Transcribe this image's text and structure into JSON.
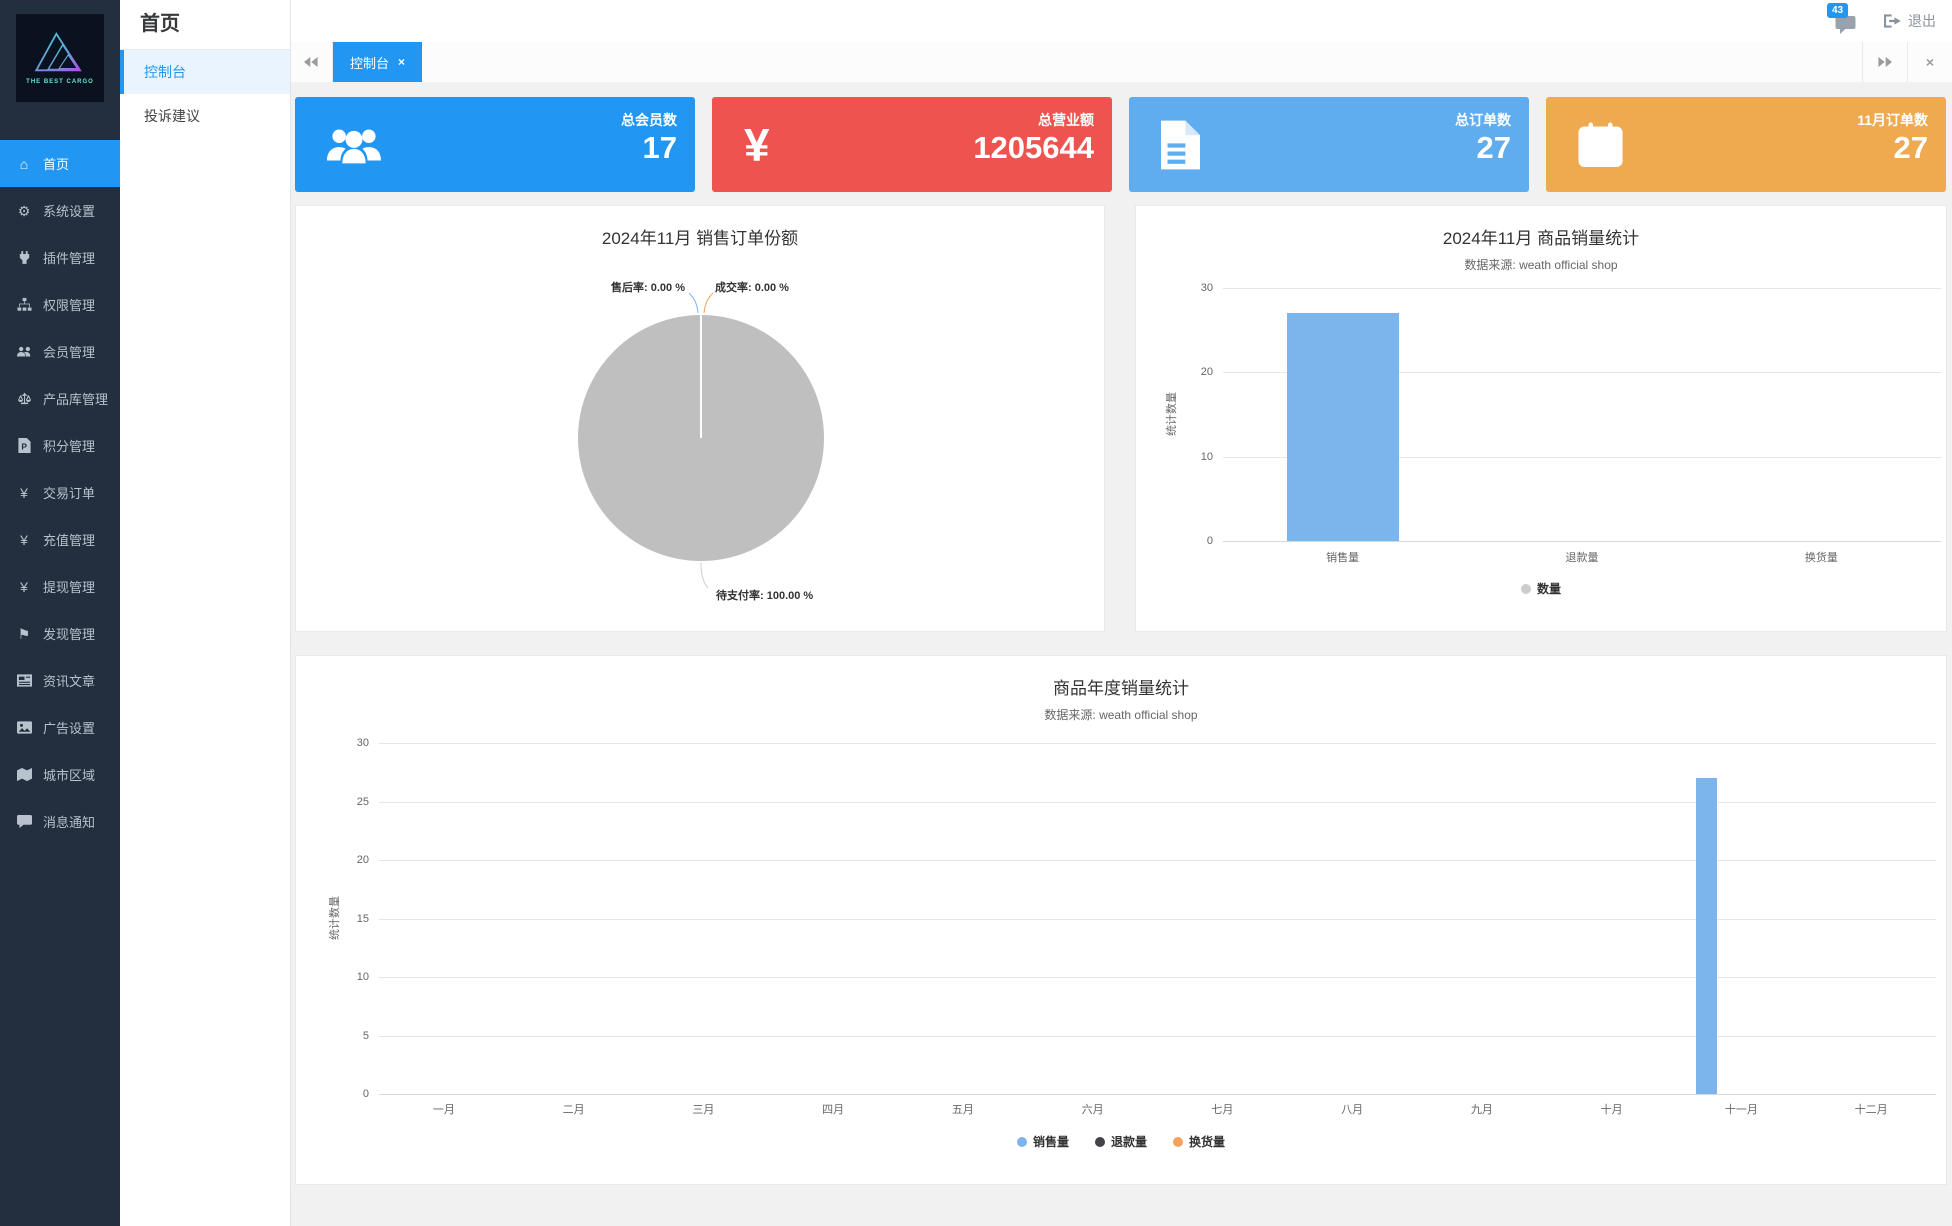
{
  "brand": {
    "name": "THE BEST CARGO"
  },
  "sidebar": {
    "active_index": 0,
    "items": [
      {
        "label": "首页",
        "icon": "home-icon"
      },
      {
        "label": "系统设置",
        "icon": "gear-icon"
      },
      {
        "label": "插件管理",
        "icon": "plugin-icon"
      },
      {
        "label": "权限管理",
        "icon": "sitemap-icon"
      },
      {
        "label": "会员管理",
        "icon": "users-icon"
      },
      {
        "label": "产品库管理",
        "icon": "scales-icon"
      },
      {
        "label": "积分管理",
        "icon": "points-file-icon"
      },
      {
        "label": "交易订单",
        "icon": "trade-yen-icon"
      },
      {
        "label": "充值管理",
        "icon": "yen-icon"
      },
      {
        "label": "提现管理",
        "icon": "yen-icon"
      },
      {
        "label": "发现管理",
        "icon": "flag-icon"
      },
      {
        "label": "资讯文章",
        "icon": "news-icon"
      },
      {
        "label": "广告设置",
        "icon": "image-icon"
      },
      {
        "label": "城市区域",
        "icon": "map-icon"
      },
      {
        "label": "消息通知",
        "icon": "comment-icon"
      }
    ]
  },
  "submenu": {
    "header": "首页",
    "active_index": 0,
    "items": [
      {
        "label": "控制台"
      },
      {
        "label": "投诉建议"
      }
    ]
  },
  "topbar": {
    "notification_count": "43",
    "notification_icon": "chat-icon",
    "logout_label": "退出",
    "logout_icon": "sign-out-icon"
  },
  "tabbar": {
    "active_tab": "控制台"
  },
  "stat_cards": [
    {
      "label": "总会员数",
      "value": "17",
      "color": "#2196f3",
      "icon": "users-group-icon"
    },
    {
      "label": "总营业额",
      "value": "1205644",
      "color": "#ef5350",
      "icon": "yen-large-icon"
    },
    {
      "label": "总订单数",
      "value": "27",
      "color": "#5fadee",
      "icon": "file-text-icon"
    },
    {
      "label": "11月订单数",
      "value": "27",
      "color": "#efa94e",
      "icon": "calendar-check-icon"
    }
  ],
  "chart_data": [
    {
      "type": "pie",
      "title": "2024年11月 销售订单份额",
      "slices": [
        {
          "label": "售后率",
          "value_pct": 0.0,
          "display": "售后率: 0.00 %",
          "line_color": "#7cb5ec"
        },
        {
          "label": "成交率",
          "value_pct": 0.0,
          "display": "成交率: 0.00 %",
          "line_color": "#f7a35c"
        },
        {
          "label": "待支付率",
          "value_pct": 100.0,
          "display": "待支付率: 100.00 %",
          "color": "#bfbfbf",
          "line_color": "#cccccc"
        }
      ]
    },
    {
      "type": "bar",
      "title": "2024年11月 商品销量统计",
      "subtitle": "数据来源: weath official shop",
      "ylabel": "统计数量",
      "ylim": [
        0,
        30
      ],
      "yticks": [
        0,
        10,
        20,
        30
      ],
      "grid": true,
      "categories": [
        "销售量",
        "退款量",
        "换货量"
      ],
      "series": [
        {
          "name": "数量",
          "values": [
            27,
            0,
            0
          ],
          "color": "#7cb5ec"
        }
      ],
      "legend": {
        "position": "bottom",
        "marker_color": "#cccccc"
      }
    },
    {
      "type": "bar",
      "title": "商品年度销量统计",
      "subtitle": "数据来源: weath official shop",
      "ylabel": "统计数量",
      "ylim": [
        0,
        30
      ],
      "yticks": [
        0,
        5,
        10,
        15,
        20,
        25,
        30
      ],
      "grid": true,
      "categories": [
        "一月",
        "二月",
        "三月",
        "四月",
        "五月",
        "六月",
        "七月",
        "八月",
        "九月",
        "十月",
        "十一月",
        "十二月"
      ],
      "series": [
        {
          "name": "销售量",
          "values": [
            0,
            0,
            0,
            0,
            0,
            0,
            0,
            0,
            0,
            0,
            27,
            0
          ],
          "color": "#7cb5ec"
        },
        {
          "name": "退款量",
          "values": [
            0,
            0,
            0,
            0,
            0,
            0,
            0,
            0,
            0,
            0,
            0,
            0
          ],
          "color": "#434348"
        },
        {
          "name": "换货量",
          "values": [
            0,
            0,
            0,
            0,
            0,
            0,
            0,
            0,
            0,
            0,
            0,
            0
          ],
          "color": "#f7a35c"
        }
      ],
      "legend": {
        "position": "bottom"
      }
    }
  ]
}
